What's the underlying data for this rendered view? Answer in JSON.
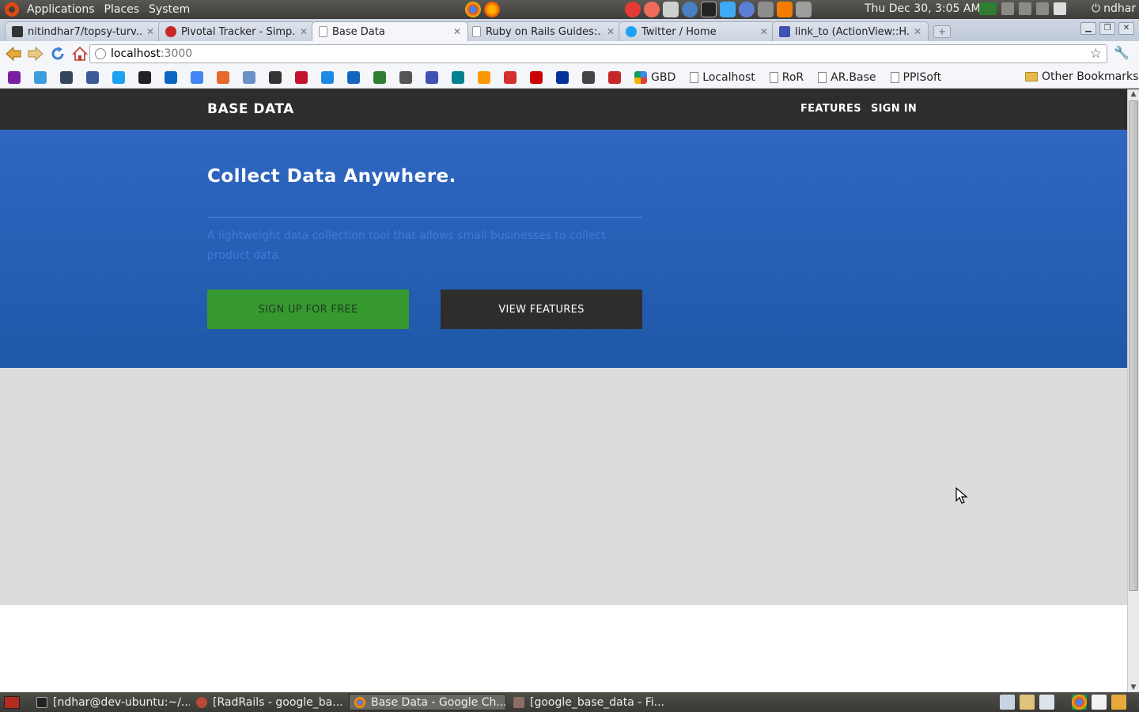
{
  "top_panel": {
    "menus": [
      "Applications",
      "Places",
      "System"
    ],
    "clock": "Thu Dec 30,  3:05 AM",
    "user": "ndhar"
  },
  "tabs": [
    {
      "title": "nitindhar7/topsy-turv...",
      "favicon": "git-icon"
    },
    {
      "title": "Pivotal Tracker - Simp...",
      "favicon": "pivotal-icon"
    },
    {
      "title": "Base Data",
      "favicon": "page-icon",
      "active": true
    },
    {
      "title": "Ruby on Rails Guides:...",
      "favicon": "page-icon"
    },
    {
      "title": "Twitter / Home",
      "favicon": "twitter-icon"
    },
    {
      "title": "link_to (ActionView::H...",
      "favicon": "apidock-icon"
    }
  ],
  "address_bar": {
    "host": "localhost",
    "port": ":3000"
  },
  "bookmarks": {
    "icon_colors": [
      "#7b1fa2",
      "#3b9ddd",
      "#35465c",
      "#3b5998",
      "#1da1f2",
      "#222",
      "#0a66c2",
      "#4285f4",
      "#e5692b",
      "#6a8fc9",
      "#333",
      "#c4122f",
      "#1e88e5",
      "#1565c0",
      "#2e7d32",
      "#555",
      "#3f51b5",
      "#00838f",
      "#ff9800",
      "#d32f2f",
      "#cc0000",
      "#003399",
      "#444",
      "#c62828"
    ],
    "gbd_label": "GBD",
    "folders": [
      "Localhost",
      "RoR",
      "AR.Base",
      "PPISoft"
    ],
    "other": "Other Bookmarks"
  },
  "site": {
    "brand": "BASE DATA",
    "nav": {
      "features": "FEATURES",
      "signin": "SIGN IN"
    },
    "hero_title": "Collect Data Anywhere.",
    "hero_subtitle": "A lightweight data collection tool that allows small businesses to collect product data.",
    "signup_button": "SIGN UP FOR FREE",
    "features_button": "VIEW FEATURES",
    "colors": {
      "nav_bg": "#2d2d2d",
      "hero_blue": "#2a5fb6",
      "signup_green": "#36992f",
      "grey": "#dcdcdc"
    }
  },
  "taskbar": {
    "tasks": [
      {
        "label": "[ndhar@dev-ubuntu:~/...",
        "icon": "terminal-icon"
      },
      {
        "label": "[RadRails - google_ba...",
        "icon": "radrails-icon"
      },
      {
        "label": "Base Data - Google Ch...",
        "icon": "chrome-icon",
        "active": true
      },
      {
        "label": "[google_base_data - Fi...",
        "icon": "file-manager-icon"
      }
    ]
  }
}
